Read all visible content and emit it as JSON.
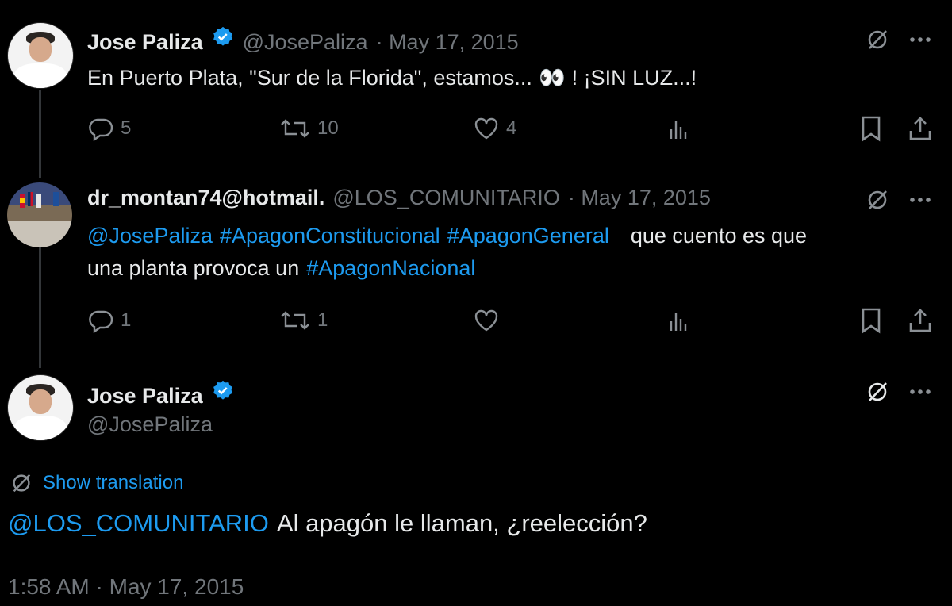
{
  "tweet1": {
    "name": "Jose Paliza",
    "handle": "@JosePaliza",
    "date": "· May 17, 2015",
    "text_before": "En Puerto Plata, \"Sur de la Florida\", estamos...",
    "emoji": "👀",
    "text_after": "! ¡SIN LUZ...!",
    "replies": "5",
    "retweets": "10",
    "likes": "4"
  },
  "tweet2": {
    "name": "dr_montan74@hotmail.",
    "handle": "@LOS_COMUNITARIO",
    "date": "· May 17, 2015",
    "mention": "@JosePaliza",
    "tag1": "#ApagonConstitucional",
    "tag2": "#ApagonGeneral",
    "text1": "que cuento es que",
    "text2": "una planta provoca un",
    "tag3": "#ApagonNacional",
    "replies": "1",
    "retweets": "1"
  },
  "tweet3": {
    "name": "Jose Paliza",
    "handle": "@JosePaliza",
    "show_translation": "Show translation",
    "mention": "@LOS_COMUNITARIO",
    "text": "Al apagón le llaman, ¿reelección?",
    "timestamp": "1:58 AM · May 17, 2015"
  },
  "colors": {
    "background": "#000000",
    "text": "#e7e9ea",
    "muted": "#71767b",
    "link": "#1d9bf0",
    "verified": "#1d9bf0"
  },
  "icons": [
    "grok-icon",
    "more-icon",
    "reply-icon",
    "retweet-icon",
    "like-icon",
    "views-icon",
    "bookmark-icon",
    "share-icon",
    "verified-badge-icon",
    "translate-icon"
  ]
}
